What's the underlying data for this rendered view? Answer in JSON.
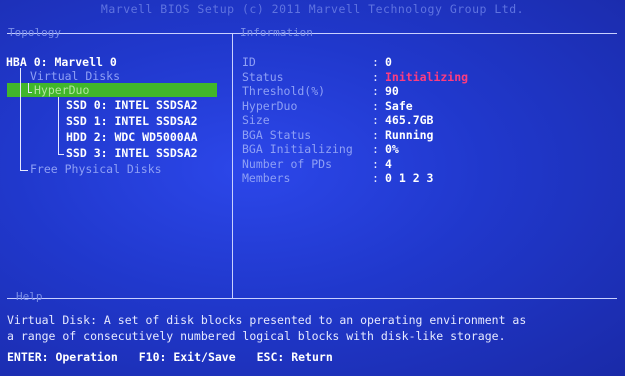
{
  "window_title": "Marvell BIOS Setup (c) 2011 Marvell Technology Group Ltd.",
  "panels": {
    "topology_label": "Topology",
    "information_label": "Information",
    "help_label": "Help"
  },
  "topology": {
    "hba": "HBA 0: Marvell 0",
    "virtual_disks": "Virtual Disks",
    "selected_vd": "HyperDuo",
    "disks": [
      "SSD 0: INTEL SSDSA2",
      "SSD 1: INTEL SSDSA2",
      "HDD 2: WDC WD5000AA",
      "SSD 3: INTEL SSDSA2"
    ],
    "free_physical": "Free Physical Disks"
  },
  "information": [
    {
      "label": "ID",
      "value": "0"
    },
    {
      "label": "Status",
      "value": "Initializing",
      "color": "#ff3c7e"
    },
    {
      "label": "Threshold(%)",
      "value": "90"
    },
    {
      "label": "HyperDuo",
      "value": "Safe"
    },
    {
      "label": "Size",
      "value": "465.7GB"
    },
    {
      "label": "BGA Status",
      "value": "Running"
    },
    {
      "label": "BGA Initializing",
      "value": "0%"
    },
    {
      "label": "Number of PDs",
      "value": "4"
    },
    {
      "label": "Members",
      "value": "0 1 2 3"
    }
  ],
  "help": {
    "line1": "Virtual Disk: A set of disk blocks presented to an operating environment as",
    "line2": "a range of consecutively numbered logical blocks with disk-like storage."
  },
  "keys": [
    "ENTER: Operation",
    "F10: Exit/Save",
    "ESC: Return"
  ],
  "colors": {
    "background": "#1b2fb8",
    "selection": "#41b62b",
    "status_alert": "#ff3c7e"
  }
}
